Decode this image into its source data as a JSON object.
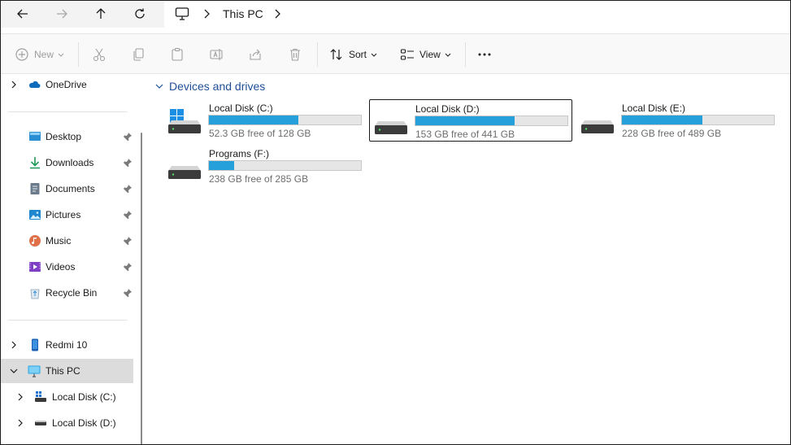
{
  "address_bar": {
    "breadcrumb_location": "This PC"
  },
  "toolbar": {
    "new_label": "New",
    "sort_label": "Sort",
    "view_label": "View"
  },
  "sidebar": {
    "onedrive": "OneDrive",
    "quick_access": [
      {
        "label": "Desktop",
        "icon": "desktop-icon"
      },
      {
        "label": "Downloads",
        "icon": "downloads-icon"
      },
      {
        "label": "Documents",
        "icon": "documents-icon"
      },
      {
        "label": "Pictures",
        "icon": "pictures-icon"
      },
      {
        "label": "Music",
        "icon": "music-icon"
      },
      {
        "label": "Videos",
        "icon": "videos-icon"
      },
      {
        "label": "Recycle Bin",
        "icon": "recycle-bin-icon"
      }
    ],
    "devices": {
      "phone": "Redmi 10",
      "this_pc": "This PC",
      "disk_c": "Local Disk (C:)",
      "disk_d": "Local Disk (D:)"
    }
  },
  "main": {
    "group_title": "Devices and drives",
    "drives": [
      {
        "name": "Local Disk (C:)",
        "free_text": "52.3 GB free of 128 GB",
        "used_fraction": 0.59,
        "system": true
      },
      {
        "name": "Local Disk (D:)",
        "free_text": "153 GB free of 441 GB",
        "used_fraction": 0.65,
        "selected": true
      },
      {
        "name": "Local Disk (E:)",
        "free_text": "228 GB free of 489 GB",
        "used_fraction": 0.53
      },
      {
        "name": "Programs (F:)",
        "free_text": "238 GB free of 285 GB",
        "used_fraction": 0.165
      }
    ]
  },
  "colors": {
    "accent": "#26a0da",
    "selection": "#dcdcdc",
    "group_title": "#1f4e96"
  }
}
